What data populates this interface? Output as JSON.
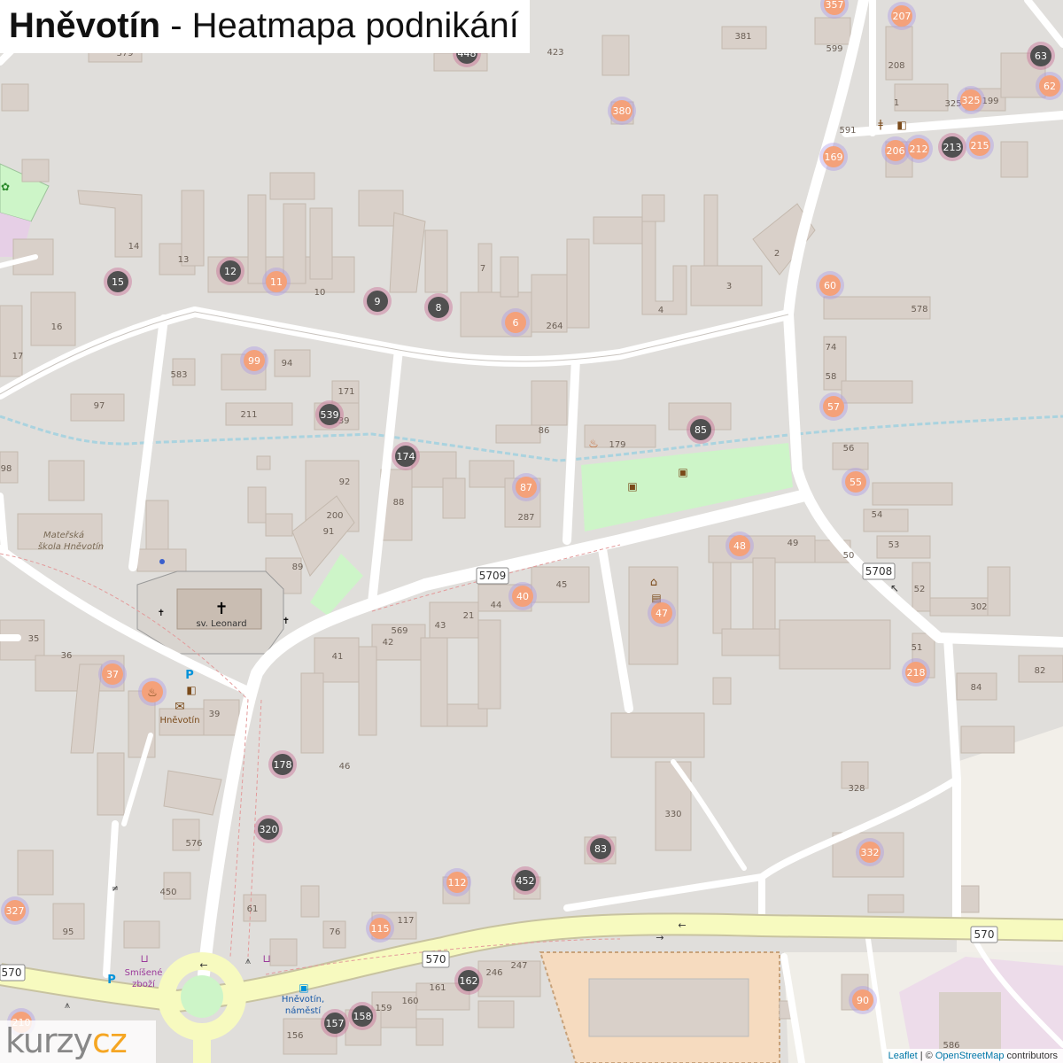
{
  "header": {
    "title_bold": "Hněvotín",
    "title_rest": " - Heatmapa podnikání"
  },
  "attribution": {
    "leaflet": "Leaflet",
    "sep": " | © ",
    "osm": "OpenStreetMap",
    "suffix": " contributors"
  },
  "logo": {
    "part1": "kurzy",
    "part2": "cz"
  },
  "colors": {
    "background": "#e5e3df",
    "building": "#d9d0c9",
    "road_primary": "#f7fabf",
    "road_residential": "#ffffff",
    "green": "#cdf5c8",
    "marker_light": "#f4a17a",
    "marker_dark": "#505050"
  },
  "map": {
    "road_shields": [
      "5709",
      "5708",
      "570",
      "570",
      "570"
    ],
    "place_labels": [
      "Mateřská",
      "škola Hněvotín",
      "sv. Leonard",
      "Hněvotín",
      "Smíšené",
      "zboží",
      "Hněvotín,",
      "náměstí"
    ],
    "house_numbers": [
      "379",
      "381",
      "599",
      "423",
      "208",
      "1",
      "325",
      "199",
      "591",
      "14",
      "13",
      "7",
      "3",
      "2",
      "10",
      "4",
      "264",
      "578",
      "16",
      "17",
      "583",
      "94",
      "171",
      "211",
      "539",
      "97",
      "86",
      "179",
      "74",
      "58",
      "56",
      "54",
      "53",
      "52",
      "302",
      "98",
      "92",
      "200",
      "91",
      "89",
      "88",
      "287",
      "49",
      "50",
      "45",
      "44",
      "21",
      "43",
      "569",
      "42",
      "41",
      "35",
      "36",
      "39",
      "46",
      "576",
      "450",
      "61",
      "76",
      "95",
      "117",
      "51",
      "84",
      "82",
      "328",
      "330",
      "246",
      "247",
      "161",
      "160",
      "159",
      "156",
      "586"
    ],
    "markers": [
      {
        "n": "357",
        "t": "light"
      },
      {
        "n": "207",
        "t": "light"
      },
      {
        "n": "448",
        "t": "dark"
      },
      {
        "n": "63",
        "t": "dark"
      },
      {
        "n": "62",
        "t": "light"
      },
      {
        "n": "380",
        "t": "light"
      },
      {
        "n": "325",
        "t": "light"
      },
      {
        "n": "169",
        "t": "light"
      },
      {
        "n": "206",
        "t": "light"
      },
      {
        "n": "212",
        "t": "light"
      },
      {
        "n": "213",
        "t": "dark"
      },
      {
        "n": "215",
        "t": "light"
      },
      {
        "n": "15",
        "t": "dark"
      },
      {
        "n": "12",
        "t": "dark"
      },
      {
        "n": "11",
        "t": "light"
      },
      {
        "n": "9",
        "t": "dark"
      },
      {
        "n": "8",
        "t": "dark"
      },
      {
        "n": "6",
        "t": "light"
      },
      {
        "n": "60",
        "t": "light"
      },
      {
        "n": "99",
        "t": "light"
      },
      {
        "n": "539",
        "t": "dark"
      },
      {
        "n": "85",
        "t": "dark"
      },
      {
        "n": "57",
        "t": "light"
      },
      {
        "n": "174",
        "t": "dark"
      },
      {
        "n": "87",
        "t": "light"
      },
      {
        "n": "55",
        "t": "light"
      },
      {
        "n": "48",
        "t": "light"
      },
      {
        "n": "40",
        "t": "light"
      },
      {
        "n": "47",
        "t": "light"
      },
      {
        "n": "37",
        "t": "light"
      },
      {
        "n": "",
        "t": "light"
      },
      {
        "n": "218",
        "t": "light"
      },
      {
        "n": "178",
        "t": "dark"
      },
      {
        "n": "320",
        "t": "dark"
      },
      {
        "n": "83",
        "t": "dark"
      },
      {
        "n": "332",
        "t": "light"
      },
      {
        "n": "112",
        "t": "light"
      },
      {
        "n": "452",
        "t": "dark"
      },
      {
        "n": "327",
        "t": "light"
      },
      {
        "n": "115",
        "t": "light"
      },
      {
        "n": "162",
        "t": "dark"
      },
      {
        "n": "158",
        "t": "dark"
      },
      {
        "n": "157",
        "t": "dark"
      },
      {
        "n": "90",
        "t": "light"
      },
      {
        "n": "210",
        "t": "light"
      }
    ]
  }
}
